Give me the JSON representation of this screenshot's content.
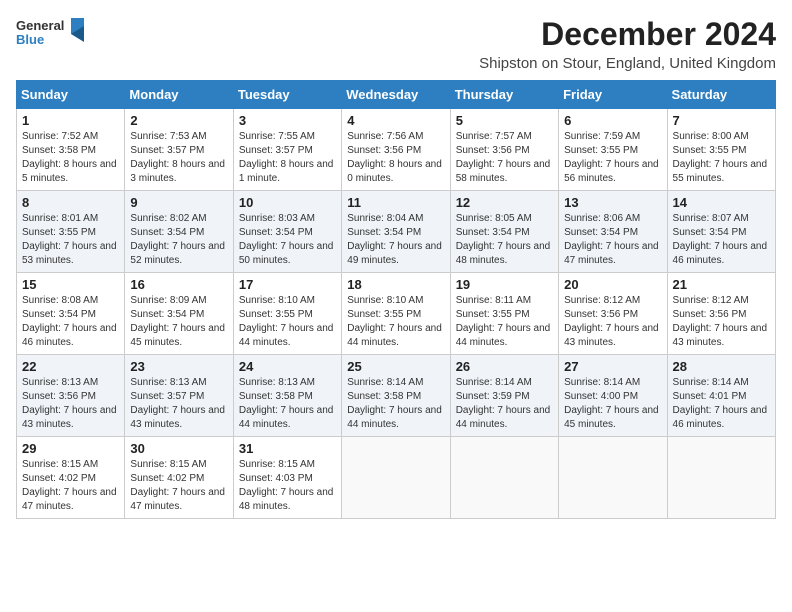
{
  "logo": {
    "text_general": "General",
    "text_blue": "Blue"
  },
  "header": {
    "title": "December 2024",
    "subtitle": "Shipston on Stour, England, United Kingdom"
  },
  "columns": [
    "Sunday",
    "Monday",
    "Tuesday",
    "Wednesday",
    "Thursday",
    "Friday",
    "Saturday"
  ],
  "weeks": [
    [
      {
        "day": "1",
        "sunrise": "Sunrise: 7:52 AM",
        "sunset": "Sunset: 3:58 PM",
        "daylight": "Daylight: 8 hours and 5 minutes."
      },
      {
        "day": "2",
        "sunrise": "Sunrise: 7:53 AM",
        "sunset": "Sunset: 3:57 PM",
        "daylight": "Daylight: 8 hours and 3 minutes."
      },
      {
        "day": "3",
        "sunrise": "Sunrise: 7:55 AM",
        "sunset": "Sunset: 3:57 PM",
        "daylight": "Daylight: 8 hours and 1 minute."
      },
      {
        "day": "4",
        "sunrise": "Sunrise: 7:56 AM",
        "sunset": "Sunset: 3:56 PM",
        "daylight": "Daylight: 8 hours and 0 minutes."
      },
      {
        "day": "5",
        "sunrise": "Sunrise: 7:57 AM",
        "sunset": "Sunset: 3:56 PM",
        "daylight": "Daylight: 7 hours and 58 minutes."
      },
      {
        "day": "6",
        "sunrise": "Sunrise: 7:59 AM",
        "sunset": "Sunset: 3:55 PM",
        "daylight": "Daylight: 7 hours and 56 minutes."
      },
      {
        "day": "7",
        "sunrise": "Sunrise: 8:00 AM",
        "sunset": "Sunset: 3:55 PM",
        "daylight": "Daylight: 7 hours and 55 minutes."
      }
    ],
    [
      {
        "day": "8",
        "sunrise": "Sunrise: 8:01 AM",
        "sunset": "Sunset: 3:55 PM",
        "daylight": "Daylight: 7 hours and 53 minutes."
      },
      {
        "day": "9",
        "sunrise": "Sunrise: 8:02 AM",
        "sunset": "Sunset: 3:54 PM",
        "daylight": "Daylight: 7 hours and 52 minutes."
      },
      {
        "day": "10",
        "sunrise": "Sunrise: 8:03 AM",
        "sunset": "Sunset: 3:54 PM",
        "daylight": "Daylight: 7 hours and 50 minutes."
      },
      {
        "day": "11",
        "sunrise": "Sunrise: 8:04 AM",
        "sunset": "Sunset: 3:54 PM",
        "daylight": "Daylight: 7 hours and 49 minutes."
      },
      {
        "day": "12",
        "sunrise": "Sunrise: 8:05 AM",
        "sunset": "Sunset: 3:54 PM",
        "daylight": "Daylight: 7 hours and 48 minutes."
      },
      {
        "day": "13",
        "sunrise": "Sunrise: 8:06 AM",
        "sunset": "Sunset: 3:54 PM",
        "daylight": "Daylight: 7 hours and 47 minutes."
      },
      {
        "day": "14",
        "sunrise": "Sunrise: 8:07 AM",
        "sunset": "Sunset: 3:54 PM",
        "daylight": "Daylight: 7 hours and 46 minutes."
      }
    ],
    [
      {
        "day": "15",
        "sunrise": "Sunrise: 8:08 AM",
        "sunset": "Sunset: 3:54 PM",
        "daylight": "Daylight: 7 hours and 46 minutes."
      },
      {
        "day": "16",
        "sunrise": "Sunrise: 8:09 AM",
        "sunset": "Sunset: 3:54 PM",
        "daylight": "Daylight: 7 hours and 45 minutes."
      },
      {
        "day": "17",
        "sunrise": "Sunrise: 8:10 AM",
        "sunset": "Sunset: 3:55 PM",
        "daylight": "Daylight: 7 hours and 44 minutes."
      },
      {
        "day": "18",
        "sunrise": "Sunrise: 8:10 AM",
        "sunset": "Sunset: 3:55 PM",
        "daylight": "Daylight: 7 hours and 44 minutes."
      },
      {
        "day": "19",
        "sunrise": "Sunrise: 8:11 AM",
        "sunset": "Sunset: 3:55 PM",
        "daylight": "Daylight: 7 hours and 44 minutes."
      },
      {
        "day": "20",
        "sunrise": "Sunrise: 8:12 AM",
        "sunset": "Sunset: 3:56 PM",
        "daylight": "Daylight: 7 hours and 43 minutes."
      },
      {
        "day": "21",
        "sunrise": "Sunrise: 8:12 AM",
        "sunset": "Sunset: 3:56 PM",
        "daylight": "Daylight: 7 hours and 43 minutes."
      }
    ],
    [
      {
        "day": "22",
        "sunrise": "Sunrise: 8:13 AM",
        "sunset": "Sunset: 3:56 PM",
        "daylight": "Daylight: 7 hours and 43 minutes."
      },
      {
        "day": "23",
        "sunrise": "Sunrise: 8:13 AM",
        "sunset": "Sunset: 3:57 PM",
        "daylight": "Daylight: 7 hours and 43 minutes."
      },
      {
        "day": "24",
        "sunrise": "Sunrise: 8:13 AM",
        "sunset": "Sunset: 3:58 PM",
        "daylight": "Daylight: 7 hours and 44 minutes."
      },
      {
        "day": "25",
        "sunrise": "Sunrise: 8:14 AM",
        "sunset": "Sunset: 3:58 PM",
        "daylight": "Daylight: 7 hours and 44 minutes."
      },
      {
        "day": "26",
        "sunrise": "Sunrise: 8:14 AM",
        "sunset": "Sunset: 3:59 PM",
        "daylight": "Daylight: 7 hours and 44 minutes."
      },
      {
        "day": "27",
        "sunrise": "Sunrise: 8:14 AM",
        "sunset": "Sunset: 4:00 PM",
        "daylight": "Daylight: 7 hours and 45 minutes."
      },
      {
        "day": "28",
        "sunrise": "Sunrise: 8:14 AM",
        "sunset": "Sunset: 4:01 PM",
        "daylight": "Daylight: 7 hours and 46 minutes."
      }
    ],
    [
      {
        "day": "29",
        "sunrise": "Sunrise: 8:15 AM",
        "sunset": "Sunset: 4:02 PM",
        "daylight": "Daylight: 7 hours and 47 minutes."
      },
      {
        "day": "30",
        "sunrise": "Sunrise: 8:15 AM",
        "sunset": "Sunset: 4:02 PM",
        "daylight": "Daylight: 7 hours and 47 minutes."
      },
      {
        "day": "31",
        "sunrise": "Sunrise: 8:15 AM",
        "sunset": "Sunset: 4:03 PM",
        "daylight": "Daylight: 7 hours and 48 minutes."
      },
      null,
      null,
      null,
      null
    ]
  ]
}
